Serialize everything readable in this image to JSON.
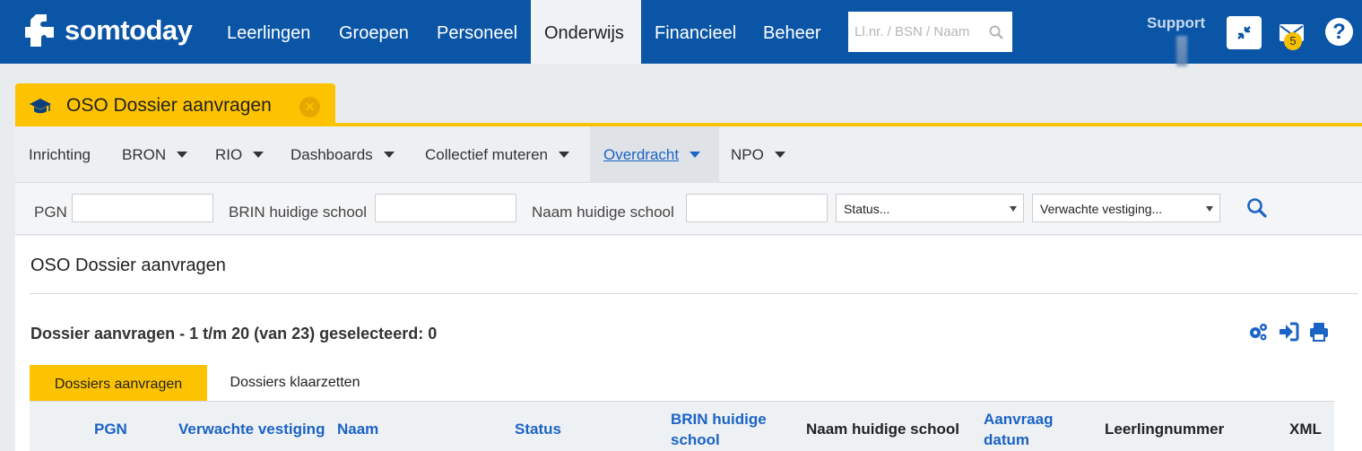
{
  "topbar": {
    "brand": "somtoday",
    "nav": [
      "Leerlingen",
      "Groepen",
      "Personeel",
      "Onderwijs",
      "Financieel",
      "Beheer"
    ],
    "active_nav": "Onderwijs",
    "search_placeholder": "Ll.nr. / BSN / Naam",
    "support_label": "Support",
    "mail_badge": "5",
    "help_label": "?"
  },
  "module": {
    "title": "OSO Dossier aanvragen"
  },
  "subnav": {
    "items": [
      {
        "label": "Inrichting",
        "dropdown": false
      },
      {
        "label": "BRON",
        "dropdown": true
      },
      {
        "label": "RIO",
        "dropdown": true
      },
      {
        "label": "Dashboards",
        "dropdown": true
      },
      {
        "label": "Collectief muteren",
        "dropdown": true
      },
      {
        "label": "Overdracht",
        "dropdown": true
      },
      {
        "label": "NPO",
        "dropdown": true
      }
    ],
    "active": "Overdracht"
  },
  "filters": {
    "pgn_label": "PGN",
    "brin_label": "BRIN huidige school",
    "naam_label": "Naam huidige school",
    "status_select": "Status...",
    "vestiging_select": "Verwachte vestiging..."
  },
  "content": {
    "page_title": "OSO Dossier aanvragen",
    "list_title": "Dossier aanvragen - 1 t/m 20 (van 23) geselecteerd: 0",
    "tabs": [
      "Dossiers aanvragen",
      "Dossiers klaarzetten"
    ],
    "active_tab": "Dossiers aanvragen",
    "columns": [
      {
        "label": "PGN",
        "sortable": true
      },
      {
        "label": "Verwachte vestiging",
        "sortable": true
      },
      {
        "label": "Naam",
        "sortable": true
      },
      {
        "label": "Status",
        "sortable": true
      },
      {
        "label": "BRIN huidige school",
        "sortable": true
      },
      {
        "label": "Naam huidige school",
        "sortable": false
      },
      {
        "label": "Aanvraag datum",
        "sortable": true
      },
      {
        "label": "Leerlingnummer",
        "sortable": false
      },
      {
        "label": "XML",
        "sortable": false
      }
    ]
  },
  "colors": {
    "brand_blue": "#0a55a6",
    "accent_yellow": "#fdc300",
    "link_blue": "#1c63c6"
  }
}
